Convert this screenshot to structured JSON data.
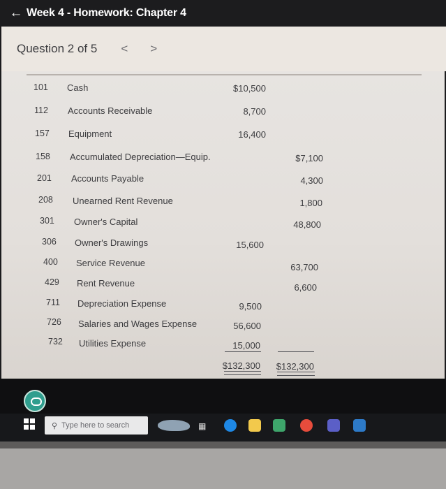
{
  "header": {
    "back_icon": "←",
    "title": "Week 4 - Homework: Chapter 4"
  },
  "question_nav": {
    "label": "Question 2 of 5",
    "prev_icon": "<",
    "next_icon": ">"
  },
  "trial_balance": {
    "rows": [
      {
        "acct": "101",
        "name": "Cash",
        "debit": "$10,500",
        "credit": ""
      },
      {
        "acct": "112",
        "name": "Accounts Receivable",
        "debit": "8,700",
        "credit": ""
      },
      {
        "acct": "157",
        "name": "Equipment",
        "debit": "16,400",
        "credit": ""
      },
      {
        "acct": "158",
        "name": "Accumulated Depreciation—Equip.",
        "debit": "",
        "credit": "$7,100"
      },
      {
        "acct": "201",
        "name": "Accounts Payable",
        "debit": "",
        "credit": "4,300"
      },
      {
        "acct": "208",
        "name": "Unearned Rent Revenue",
        "debit": "",
        "credit": "1,800"
      },
      {
        "acct": "301",
        "name": "Owner's Capital",
        "debit": "",
        "credit": "48,800"
      },
      {
        "acct": "306",
        "name": "Owner's Drawings",
        "debit": "15,600",
        "credit": ""
      },
      {
        "acct": "400",
        "name": "Service Revenue",
        "debit": "",
        "credit": "63,700"
      },
      {
        "acct": "429",
        "name": "Rent Revenue",
        "debit": "",
        "credit": "6,600"
      },
      {
        "acct": "711",
        "name": "Depreciation Expense",
        "debit": "9,500",
        "credit": ""
      },
      {
        "acct": "726",
        "name": "Salaries and Wages Expense",
        "debit": "56,600",
        "credit": ""
      },
      {
        "acct": "732",
        "name": "Utilities Expense",
        "debit": "15,000",
        "credit": ""
      }
    ],
    "total_debit": "$132,300",
    "total_credit": "$132,300"
  },
  "taskbar": {
    "search_placeholder": "Type here to search",
    "search_icon": "search-icon",
    "windows_icon": "windows-start-icon",
    "task_view_icon": "task-view-icon",
    "apps": [
      "edge-icon",
      "file-explorer-icon",
      "store-icon",
      "chrome-icon",
      "teams-icon",
      "mail-icon"
    ]
  },
  "colors": {
    "title_bar": "#1c1c1e",
    "question_bar": "#ece7e1",
    "paper": "#e5e1dd",
    "help_icon": "#2f9e8e"
  }
}
